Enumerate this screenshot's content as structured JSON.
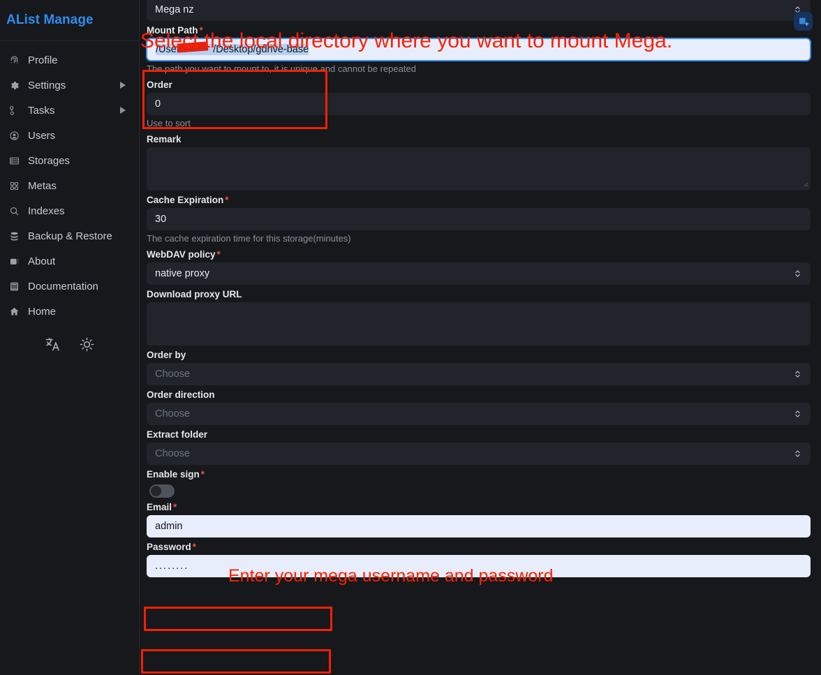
{
  "app": {
    "brand": "AList Manage"
  },
  "sidebar": {
    "items": [
      {
        "label": "Profile",
        "icon": "fingerprint-icon",
        "expandable": false
      },
      {
        "label": "Settings",
        "icon": "gear-icon",
        "expandable": true
      },
      {
        "label": "Tasks",
        "icon": "tasks-icon",
        "expandable": true
      },
      {
        "label": "Users",
        "icon": "user-circle-icon",
        "expandable": false
      },
      {
        "label": "Storages",
        "icon": "server-icon",
        "expandable": false
      },
      {
        "label": "Metas",
        "icon": "metas-icon",
        "expandable": false
      },
      {
        "label": "Indexes",
        "icon": "search-icon",
        "expandable": false
      },
      {
        "label": "Backup & Restore",
        "icon": "database-icon",
        "expandable": false
      },
      {
        "label": "About",
        "icon": "info-box-icon",
        "expandable": false
      },
      {
        "label": "Documentation",
        "icon": "book-icon",
        "expandable": false
      },
      {
        "label": "Home",
        "icon": "home-icon",
        "expandable": false
      }
    ],
    "tools": [
      {
        "name": "language-icon"
      },
      {
        "name": "theme-sun-icon"
      }
    ]
  },
  "topbar": {
    "add_storage_icon": "add-storage-icon"
  },
  "form": {
    "driver": {
      "value": "Mega nz"
    },
    "mount_path": {
      "label": "Mount Path",
      "required": true,
      "value": "/Users/",
      "value_tail": "/Desktop/gdrive-base",
      "hint": "The path you want to mount to, it is unique and cannot be repeated"
    },
    "order": {
      "label": "Order",
      "required": false,
      "value": "0",
      "hint": "Use to sort"
    },
    "remark": {
      "label": "Remark",
      "required": false,
      "value": ""
    },
    "cache_expiration": {
      "label": "Cache Expiration",
      "required": true,
      "value": "30",
      "hint": "The cache expiration time for this storage(minutes)"
    },
    "webdav_policy": {
      "label": "WebDAV policy",
      "required": true,
      "value": "native proxy"
    },
    "download_proxy_url": {
      "label": "Download proxy URL",
      "required": false,
      "value": ""
    },
    "order_by": {
      "label": "Order by",
      "required": false,
      "value": "",
      "placeholder": "Choose"
    },
    "order_direction": {
      "label": "Order direction",
      "required": false,
      "value": "",
      "placeholder": "Choose"
    },
    "extract_folder": {
      "label": "Extract folder",
      "required": false,
      "value": "",
      "placeholder": "Choose"
    },
    "enable_sign": {
      "label": "Enable sign",
      "required": true,
      "state": "off"
    },
    "email": {
      "label": "Email",
      "required": true,
      "value": "admin"
    },
    "password": {
      "label": "Password",
      "required": true,
      "value": "........"
    }
  },
  "annotations": {
    "top": "Select the local directory where you want to mount Mega.",
    "credentials": "Enter your mega username and password",
    "color": "#fa2200"
  },
  "colors": {
    "brand": "#2e8ef0",
    "annotation_red": "#fa2200",
    "required_star": "#f0503a",
    "page_bg": "#16181c",
    "control_bg": "#21242a",
    "autofill_bg": "#e8edfb"
  }
}
